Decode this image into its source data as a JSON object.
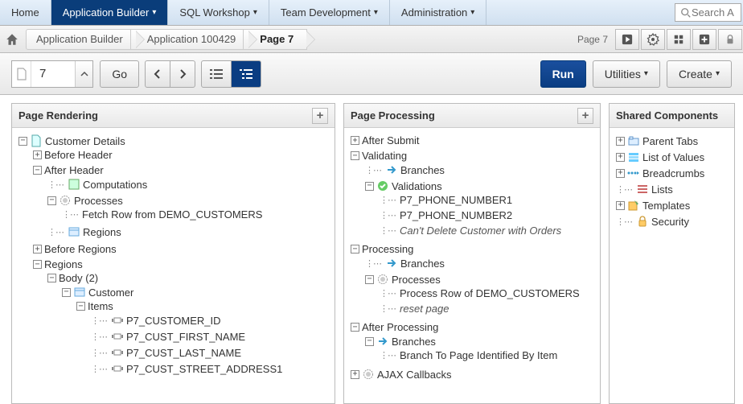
{
  "topnav": {
    "home": "Home",
    "app_builder": "Application Builder",
    "sql": "SQL Workshop",
    "team": "Team Development",
    "admin": "Administration",
    "search_placeholder": "Search A"
  },
  "breadcrumb": {
    "app_builder": "Application Builder",
    "application": "Application 100429",
    "page": "Page 7",
    "page_label": "Page 7"
  },
  "toolbar": {
    "page_num": "7",
    "go": "Go",
    "run": "Run",
    "utilities": "Utilities",
    "create": "Create"
  },
  "panes": {
    "rendering_title": "Page Rendering",
    "processing_title": "Page Processing",
    "shared_title": "Shared Components"
  },
  "rendering": {
    "root": "Customer Details",
    "before_header": "Before Header",
    "after_header": "After Header",
    "computations": "Computations",
    "processes": "Processes",
    "fetch_row": "Fetch Row from DEMO_CUSTOMERS",
    "regions": "Regions",
    "before_regions": "Before Regions",
    "regions2": "Regions",
    "body": "Body (2)",
    "customer": "Customer",
    "items": "Items",
    "p7_customer_id": "P7_CUSTOMER_ID",
    "p7_first": "P7_CUST_FIRST_NAME",
    "p7_last": "P7_CUST_LAST_NAME",
    "p7_street": "P7_CUST_STREET_ADDRESS1"
  },
  "processing": {
    "after_submit": "After Submit",
    "validating": "Validating",
    "branches": "Branches",
    "validations": "Validations",
    "phone1": "P7_PHONE_NUMBER1",
    "phone2": "P7_PHONE_NUMBER2",
    "cant_delete": "Can't Delete Customer with Orders",
    "processing": "Processing",
    "processes": "Processes",
    "process_row": "Process Row of DEMO_CUSTOMERS",
    "reset_page": "reset page",
    "after_processing": "After Processing",
    "branch_to": "Branch To Page Identified By Item",
    "ajax": "AJAX Callbacks"
  },
  "shared": {
    "parent_tabs": "Parent Tabs",
    "lov": "List of Values",
    "breadcrumbs": "Breadcrumbs",
    "lists": "Lists",
    "templates": "Templates",
    "security": "Security"
  }
}
